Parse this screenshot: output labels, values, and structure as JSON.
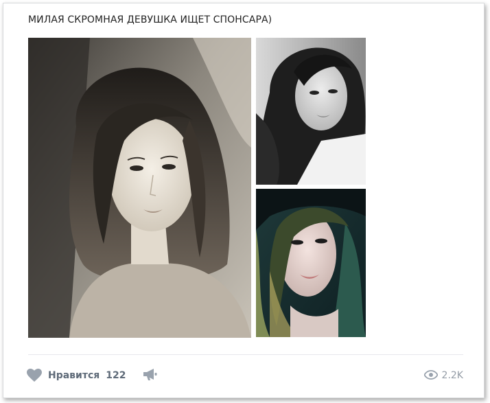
{
  "post": {
    "text": "МИЛАЯ СКРОМНАЯ ДЕВУШКА ИЩЕТ СПОНСАРА)"
  },
  "photos": [
    {
      "icon": "portrait-photo",
      "tone": "sepia-grayscale"
    },
    {
      "icon": "portrait-photo",
      "tone": "grayscale"
    },
    {
      "icon": "portrait-photo",
      "tone": "teal-color"
    }
  ],
  "footer": {
    "like_label": "Нравится",
    "like_count": "122",
    "views_count": "2.2K",
    "icons": {
      "like": "heart-icon",
      "share": "megaphone-icon",
      "views": "eye-icon"
    },
    "colors": {
      "action": "#5e6a78",
      "icon": "#99a2ad",
      "views_text": "#939ba5"
    }
  }
}
